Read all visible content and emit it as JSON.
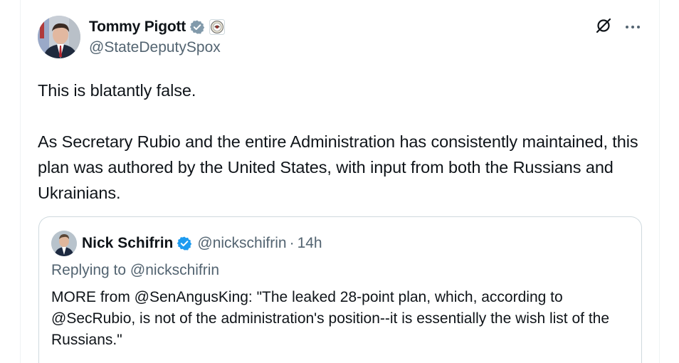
{
  "author": {
    "display_name": "Tommy Pigott",
    "handle": "@StateDeputySpox"
  },
  "tweet": {
    "paragraphs": [
      "This is blatantly false.",
      "As Secretary Rubio and the entire Administration has consistently maintained, this plan was authored by the United States, with input from both the Russians and Ukrainians."
    ]
  },
  "quoted": {
    "display_name": "Nick Schifrin",
    "handle": "@nickschifrin",
    "separator": "·",
    "time": "14h",
    "replying_prefix": "Replying to",
    "replying_to": "@nickschifrin",
    "text": "MORE from @SenAngusKing: \"The leaked 28-point plan, which, according to @SecRubio, is not of the administration's position--it is essentially the wish list of the Russians.\""
  },
  "colors": {
    "verified_blue": "#1d9bf0",
    "verified_gray": "#829aab",
    "text_primary": "#0f1419",
    "text_secondary": "#536471",
    "border": "#cfd9de"
  },
  "icons": {
    "verified": "verified-badge-icon",
    "affiliate": "state-department-seal-icon",
    "grok": "grok-icon",
    "more": "more-options-icon"
  }
}
